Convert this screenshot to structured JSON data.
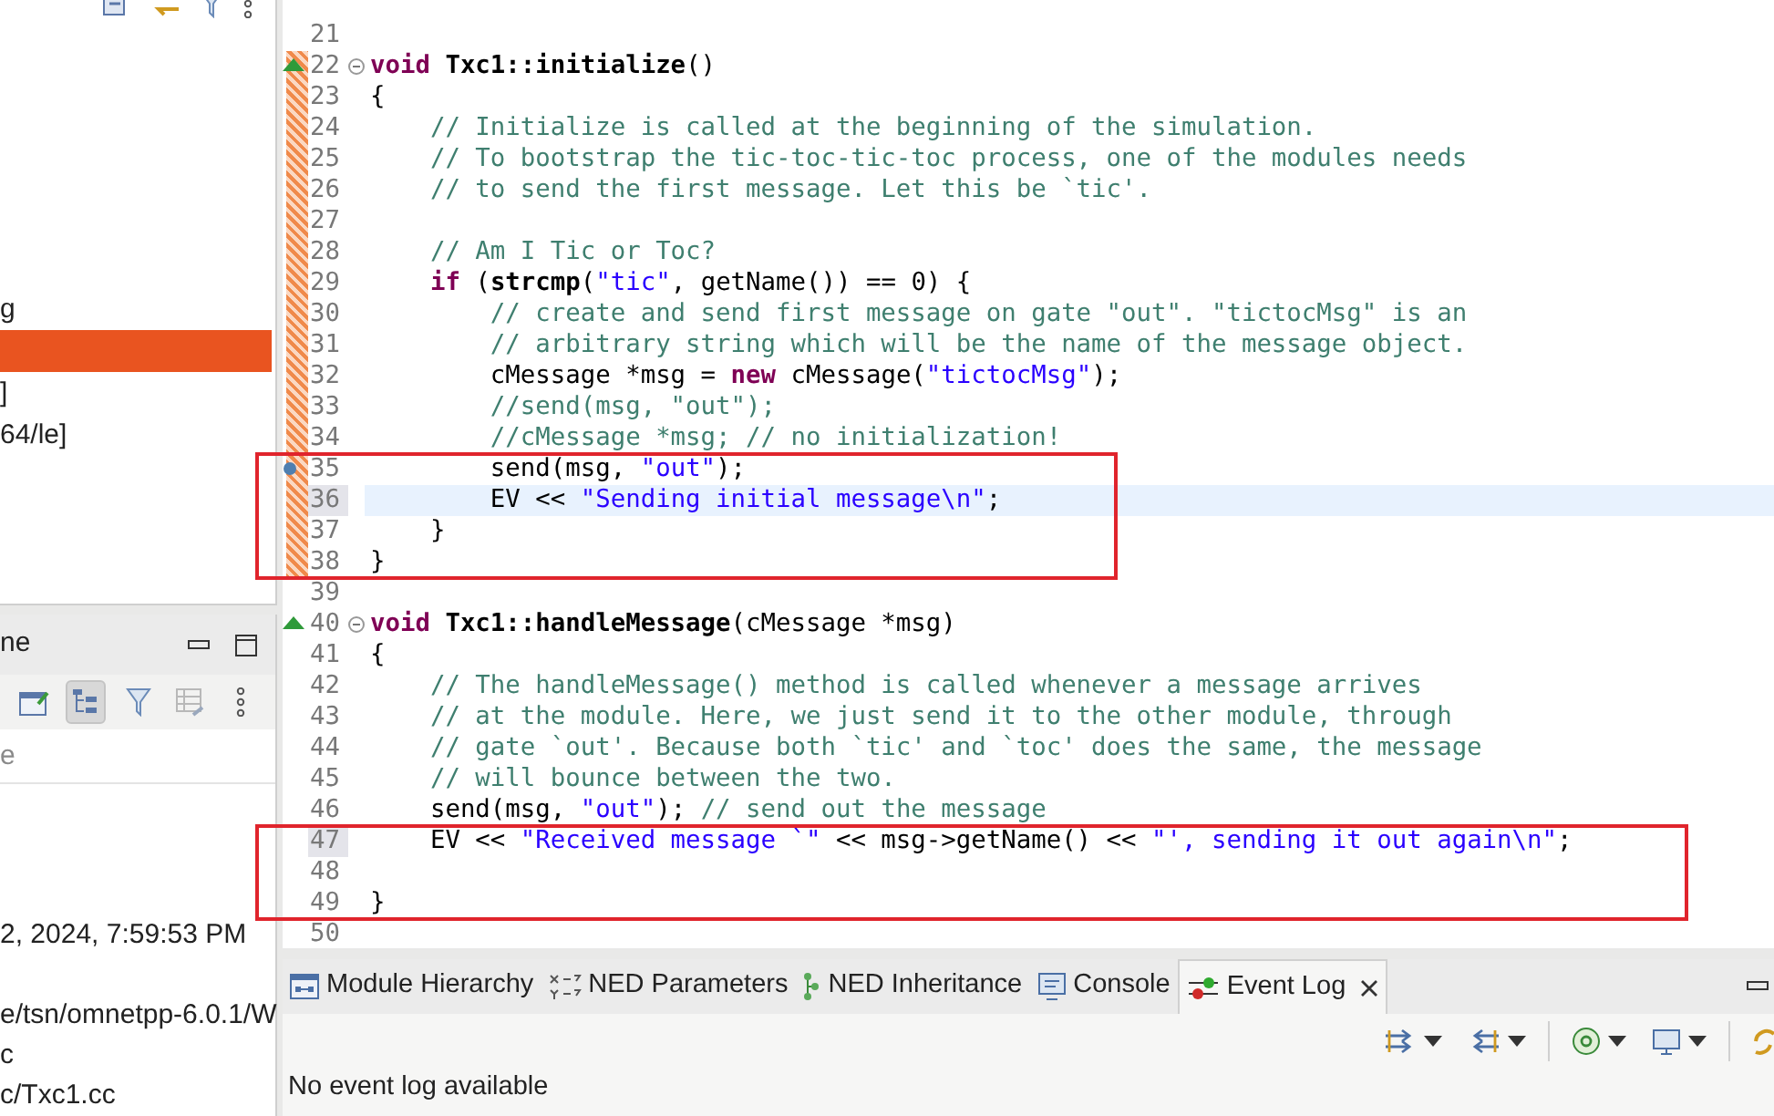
{
  "explorer": {
    "rows": [
      {
        "text": "g",
        "selected": false
      },
      {
        "selected": true
      },
      {
        "text": "]",
        "selected": false
      },
      {
        "text": "64/le]",
        "selected": false
      }
    ]
  },
  "outline": {
    "title": "ne",
    "header": "e",
    "rows": [
      "2, 2024, 7:59:53 PM",
      "e/tsn/omnetpp-6.0.1/W",
      "c",
      "c/Txc1.cc"
    ]
  },
  "code_lines": [
    {
      "num": "21"
    },
    {
      "num": "22",
      "changed": true,
      "override_marker": true,
      "fold": true,
      "tokens": [
        {
          "kind": "keyword",
          "t": "void "
        },
        {
          "kind": "bold",
          "t": "Txc1::initialize"
        },
        {
          "kind": "plain",
          "t": "()"
        }
      ]
    },
    {
      "num": "23",
      "changed": true,
      "tokens": [
        {
          "kind": "plain",
          "t": "{"
        }
      ]
    },
    {
      "num": "24",
      "changed": true,
      "tokens": [
        {
          "kind": "comment",
          "t": "    // Initialize is called at the beginning of the simulation."
        }
      ]
    },
    {
      "num": "25",
      "changed": true,
      "tokens": [
        {
          "kind": "comment",
          "t": "    // To bootstrap the tic-toc-tic-toc process, one of the modules needs"
        }
      ]
    },
    {
      "num": "26",
      "changed": true,
      "tokens": [
        {
          "kind": "comment",
          "t": "    // to send the first message. Let this be `tic'."
        }
      ]
    },
    {
      "num": "27",
      "changed": true
    },
    {
      "num": "28",
      "changed": true,
      "tokens": [
        {
          "kind": "comment",
          "t": "    // Am I Tic or Toc?"
        }
      ]
    },
    {
      "num": "29",
      "changed": true,
      "tokens": [
        {
          "kind": "keyword",
          "t": "    if"
        },
        {
          "kind": "plain",
          "t": " ("
        },
        {
          "kind": "bold",
          "t": "strcmp"
        },
        {
          "kind": "plain",
          "t": "("
        },
        {
          "kind": "string",
          "t": "\"tic\""
        },
        {
          "kind": "plain",
          "t": ", getName()) == 0) {"
        }
      ]
    },
    {
      "num": "30",
      "changed": true,
      "tokens": [
        {
          "kind": "comment",
          "t": "        // create and send first message on gate \"out\". \"tictocMsg\" is an"
        }
      ]
    },
    {
      "num": "31",
      "changed": true,
      "tokens": [
        {
          "kind": "comment",
          "t": "        // arbitrary string which will be the name of the message object."
        }
      ]
    },
    {
      "num": "32",
      "changed": true,
      "tokens": [
        {
          "kind": "plain",
          "t": "        cMessage *msg = "
        },
        {
          "kind": "keyword",
          "t": "new"
        },
        {
          "kind": "plain",
          "t": " cMessage("
        },
        {
          "kind": "string",
          "t": "\"tictocMsg\""
        },
        {
          "kind": "plain",
          "t": ");"
        }
      ]
    },
    {
      "num": "33",
      "changed": true,
      "tokens": [
        {
          "kind": "comment",
          "t": "        //send(msg, \"out\");"
        }
      ]
    },
    {
      "num": "34",
      "changed": true,
      "tokens": [
        {
          "kind": "comment",
          "t": "        //cMessage *msg; // no initialization!"
        }
      ]
    },
    {
      "num": "35",
      "changed": true,
      "boxed": true,
      "breakpoint": true,
      "tokens": [
        {
          "kind": "plain",
          "t": "        send(msg, "
        },
        {
          "kind": "string",
          "t": "\"out\""
        },
        {
          "kind": "plain",
          "t": ");"
        }
      ]
    },
    {
      "num": "36",
      "changed": true,
      "boxed": true,
      "current": true,
      "num_highlight": true,
      "tokens": [
        {
          "kind": "plain",
          "t": "        EV << "
        },
        {
          "kind": "string",
          "t": "\"Sending initial message\\n\""
        },
        {
          "kind": "plain",
          "t": ";"
        }
      ]
    },
    {
      "num": "37",
      "changed": true,
      "boxed": true,
      "tokens": [
        {
          "kind": "plain",
          "t": "    }"
        }
      ]
    },
    {
      "num": "38",
      "changed": true,
      "boxed": true,
      "tokens": [
        {
          "kind": "plain",
          "t": "}"
        }
      ]
    },
    {
      "num": "39"
    },
    {
      "num": "40",
      "override_marker": true,
      "fold": true,
      "tokens": [
        {
          "kind": "keyword",
          "t": "void "
        },
        {
          "kind": "bold",
          "t": "Txc1::handleMessage"
        },
        {
          "kind": "plain",
          "t": "(cMessage *msg)"
        }
      ]
    },
    {
      "num": "41",
      "tokens": [
        {
          "kind": "plain",
          "t": "{"
        }
      ]
    },
    {
      "num": "42",
      "tokens": [
        {
          "kind": "comment",
          "t": "    // The handleMessage() method is called whenever a message arrives"
        }
      ]
    },
    {
      "num": "43",
      "tokens": [
        {
          "kind": "comment",
          "t": "    // at the module. Here, we just send it to the other module, through"
        }
      ]
    },
    {
      "num": "44",
      "tokens": [
        {
          "kind": "comment",
          "t": "    // gate `out'. Because both `tic' and `toc' does the same, the message"
        }
      ]
    },
    {
      "num": "45",
      "tokens": [
        {
          "kind": "comment",
          "t": "    // will bounce between the two."
        }
      ]
    },
    {
      "num": "46",
      "tokens": [
        {
          "kind": "plain",
          "t": "    send(msg, "
        },
        {
          "kind": "string",
          "t": "\"out\""
        },
        {
          "kind": "plain",
          "t": "); "
        },
        {
          "kind": "comment",
          "t": "// send out the message"
        }
      ]
    },
    {
      "num": "47",
      "boxed": true,
      "num_highlight": true,
      "tokens": [
        {
          "kind": "plain",
          "t": "    EV << "
        },
        {
          "kind": "string",
          "t": "\"Received message `\""
        },
        {
          "kind": "plain",
          "t": " << msg->getName() << "
        },
        {
          "kind": "string",
          "t": "\"', sending it out again\\n\""
        },
        {
          "kind": "plain",
          "t": ";"
        }
      ]
    },
    {
      "num": "48",
      "boxed": true
    },
    {
      "num": "49",
      "boxed": true,
      "tokens": [
        {
          "kind": "plain",
          "t": "}"
        }
      ]
    },
    {
      "num": "50"
    }
  ],
  "bottom_panel": {
    "tabs": [
      {
        "label": "Module Hierarchy",
        "selected": false
      },
      {
        "label": "NED Parameters",
        "selected": false
      },
      {
        "label": "NED Inheritance",
        "selected": false
      },
      {
        "label": "Console",
        "selected": false
      },
      {
        "label": "Event Log",
        "selected": true
      }
    ],
    "message": "No event log available"
  }
}
